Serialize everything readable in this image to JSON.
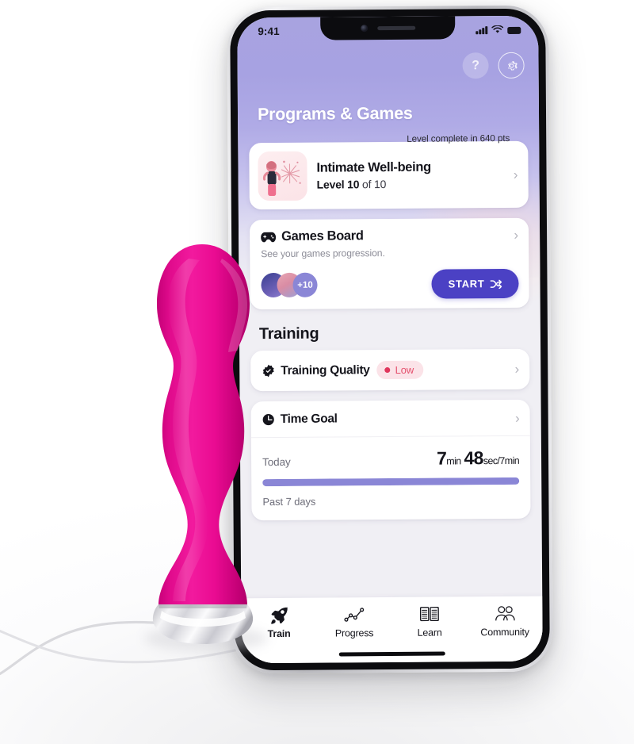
{
  "status_bar": {
    "time": "9:41",
    "icons": [
      "signal-bars-icon",
      "wifi-icon",
      "battery-icon"
    ]
  },
  "top_actions": {
    "help_label": "?",
    "help_name": "help-icon",
    "settings_name": "gear-icon"
  },
  "header": {
    "title": "Programs & Games"
  },
  "level_card": {
    "banner": "Level complete in 640 pts",
    "thumbnail_name": "celebration-fireworks-thumbnail",
    "title": "Intimate Well-being",
    "level_prefix": "Level 10",
    "level_suffix": " of 10",
    "chevron": "›"
  },
  "games_card": {
    "icon_name": "gamepad-icon",
    "title": "Games Board",
    "subtitle": "See your games progression.",
    "chevron": "›",
    "avatars": [
      {
        "name": "avatar-1",
        "label": ""
      },
      {
        "name": "avatar-2",
        "label": ""
      },
      {
        "name": "avatar-count",
        "label": "+10"
      }
    ],
    "start_label": "START",
    "start_icon_name": "shuffle-icon"
  },
  "training": {
    "section_title": "Training",
    "quality": {
      "icon_name": "verified-badge-icon",
      "label": "Training Quality",
      "status": "Low",
      "status_color": "#e5526f",
      "status_bg": "#fbe3e8",
      "chevron": "›"
    },
    "time_goal": {
      "icon_name": "clock-icon",
      "label": "Time Goal",
      "chevron": "›",
      "today_label": "Today",
      "value_minutes": "7",
      "unit_min": "min",
      "value_seconds": "48",
      "unit_sec": "sec/7min",
      "progress_percent": 100,
      "progress_color": "#8a86d6",
      "past_label": "Past 7 days"
    }
  },
  "tab_bar": {
    "tabs": [
      {
        "label": "Train",
        "icon": "rocket-icon",
        "active": true
      },
      {
        "label": "Progress",
        "icon": "line-chart-icon",
        "active": false
      },
      {
        "label": "Learn",
        "icon": "open-book-icon",
        "active": false
      },
      {
        "label": "Community",
        "icon": "people-group-icon",
        "active": false
      }
    ]
  },
  "product": {
    "name": "pink-silicone-device",
    "body_color": "#e9098f",
    "base_color": "#d8d8dc",
    "cable_name": "charging-cable"
  },
  "theme": {
    "gradient_top": "#a8a3e0",
    "accent_purple": "#4b41c4",
    "card_bg": "#ffffff"
  }
}
